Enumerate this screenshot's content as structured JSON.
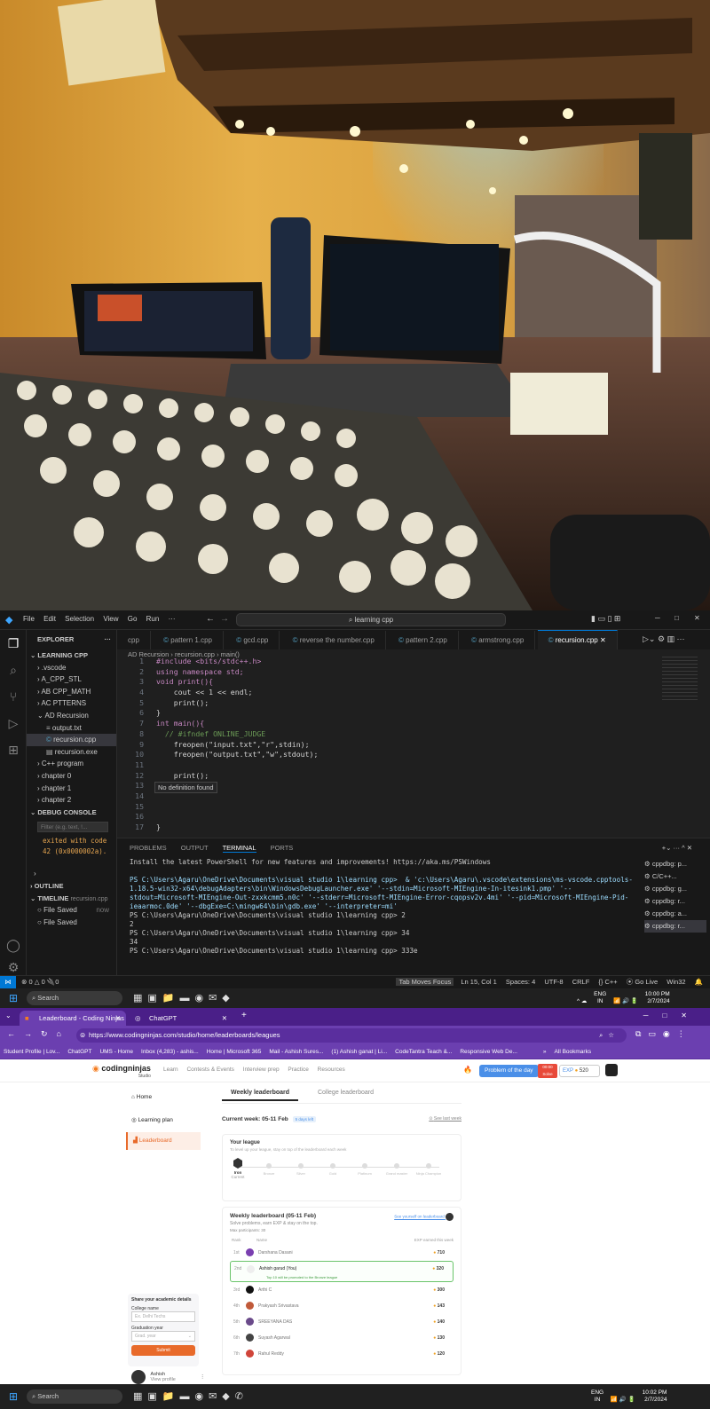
{
  "vscode": {
    "menu": [
      "File",
      "Edit",
      "Selection",
      "View",
      "Go",
      "Run",
      "···"
    ],
    "search_box": "learning cpp",
    "tabs": [
      "cpp",
      "pattern 1.cpp",
      "gcd.cpp",
      "reverse the number.cpp",
      "pattern 2.cpp",
      "armstrong.cpp",
      "recursion.cpp"
    ],
    "explorer_title": "EXPLORER",
    "explorer_more": "···",
    "tree": [
      "LEARNING CPP",
      ".vscode",
      "A_CPP_STL",
      "AB CPP_MATH",
      "AC PTTERNS",
      "AD Recursion",
      "output.txt",
      "recursion.cpp",
      "recursion.exe",
      "C++ program",
      "chapter 0",
      "chapter 1",
      "chapter 2"
    ],
    "debug_console": {
      "title": "DEBUG CONSOLE",
      "filter_placeholder": "Filter (e.g. text, !...",
      "output": "exited with code 42 (0x0000002a)."
    },
    "outline": "OUTLINE",
    "timeline": {
      "title": "TIMELINE",
      "file": "recursion.cpp",
      "entries": [
        {
          "label": "File Saved",
          "time": "now"
        },
        {
          "label": "File Saved",
          "time": ""
        }
      ]
    },
    "breadcrumb": [
      "AD Recursion",
      "recursion.cpp",
      "main()"
    ],
    "code": [
      {
        "n": "1",
        "t": "#include <bits/stdc++.h>"
      },
      {
        "n": "2",
        "t": "using namespace std;"
      },
      {
        "n": "3",
        "t": "void print(){"
      },
      {
        "n": "4",
        "t": "    cout << 1 << endl;"
      },
      {
        "n": "5",
        "t": "    print();"
      },
      {
        "n": "6",
        "t": "}"
      },
      {
        "n": "7",
        "t": "int main(){"
      },
      {
        "n": "8",
        "t": "  // #ifndef ONLINE_JUDGE"
      },
      {
        "n": "9",
        "t": "    freopen(\"input.txt\",\"r\",stdin);"
      },
      {
        "n": "10",
        "t": "    freopen(\"output.txt\",\"w\",stdout);"
      },
      {
        "n": "11",
        "t": ""
      },
      {
        "n": "12",
        "t": "    print();"
      },
      {
        "n": "13",
        "t": ""
      },
      {
        "n": "14",
        "t": ""
      },
      {
        "n": "15",
        "t": ""
      },
      {
        "n": "16",
        "t": ""
      },
      {
        "n": "17",
        "t": "}"
      }
    ],
    "hover_hint": "No definition found",
    "panel_tabs": [
      "PROBLEMS",
      "OUTPUT",
      "TERMINAL",
      "PORTS"
    ],
    "terminal": [
      "Install the latest PowerShell for new features and improvements! https://aka.ms/PSWindows",
      "",
      "PS C:\\Users\\Agaru\\OneDrive\\Documents\\visual studio 1\\learning cpp>  & 'c:\\Users\\Agaru\\.vscode\\extensions\\ms-vscode.cpptools-1.18.5-win32-x64\\debugAdapters\\bin\\WindowsDebugLauncher.exe' '--stdin=Microsoft-MIEngine-In-itesink1.pmp' '--stdout=Microsoft-MIEngine-Out-zxxkcmm5.n0c' '--stderr=Microsoft-MIEngine-Error-cqopsv2v.4mi' '--pid=Microsoft-MIEngine-Pid-ieaarmoc.0de' '--dbgExe=C:\\mingw64\\bin\\gdb.exe' '--interpreter=mi'",
      "PS C:\\Users\\Agaru\\OneDrive\\Documents\\visual studio 1\\learning cpp> 2",
      "2",
      "PS C:\\Users\\Agaru\\OneDrive\\Documents\\visual studio 1\\learning cpp> 34",
      "34",
      "PS C:\\Users\\Agaru\\OneDrive\\Documents\\visual studio 1\\learning cpp> 333e"
    ],
    "terminal_list": [
      "cppdbg: p...",
      "C/C++...",
      "cppdbg: g...",
      "cppdbg: r...",
      "cppdbg: a...",
      "cppdbg: r..."
    ],
    "status": {
      "errors": "0",
      "warnings": "0",
      "ports": "0",
      "tab_focus": "Tab Moves Focus",
      "position": "Ln 15, Col 1",
      "spaces": "Spaces: 4",
      "encoding": "UTF-8",
      "eol": "CRLF",
      "lang": "C++",
      "golive": "Go Live",
      "platform": "Win32"
    }
  },
  "taskbar1": {
    "search": "Search",
    "lang": "ENG",
    "region": "IN",
    "time": "10:00 PM",
    "date": "2/7/2024"
  },
  "chrome": {
    "tabs": [
      "Leaderboard - Coding Ninjas",
      "ChatGPT"
    ],
    "new_tab": "+",
    "url": "https://www.codingninjas.com/studio/home/leaderboards/leagues",
    "bookmarks": [
      "Student Profile | Lov...",
      "ChatGPT",
      "UMS - Home",
      "Inbox (4,283) - ashis...",
      "Home | Microsoft 365",
      "Mail - Ashish Sures...",
      "(1) Ashish ganat | Li...",
      "CodeTantra Teach &...",
      "Responsive Web De..."
    ],
    "bookmarks_more": "»",
    "all_bookmarks": "All Bookmarks"
  },
  "site": {
    "logo": "codingninjas",
    "logo_sub": "Studio",
    "nav": [
      "Learn",
      "Contests & Events",
      "Interview prep",
      "Practice",
      "Resources"
    ],
    "potd": "Problem of the day",
    "potd_badge": "00:00 Solve",
    "exp": "EXP",
    "exp_value": "520",
    "sidenav": [
      "Home",
      "Learning plan",
      "Leaderboard"
    ],
    "lb_tabs": [
      "Weekly leaderboard",
      "College leaderboard"
    ],
    "current_week": "Current week: 05-11 Feb",
    "days_left": "5 days left",
    "see_last_week": "See last week",
    "league_title": "Your league",
    "league_sub": "To level up your league, stay on top of the leaderboard each week",
    "league_current": "Iron",
    "league_current_sub": "Current",
    "leagues": [
      "Bronze",
      "Silver",
      "Gold",
      "Platinum",
      "Grand master",
      "Ninja Champion"
    ],
    "weekly_title": "Weekly leaderboard (05-11 Feb)",
    "see_self": "See yourself on leaderboard",
    "weekly_sub": "Solve problems, earn EXP & stay on the top.",
    "participants": "Max participants: 30",
    "col_rank": "Rank",
    "col_name": "Name",
    "col_exp": "EXP earned this week",
    "rows": [
      {
        "rank": "1st",
        "name": "Darshana Dasani",
        "exp": "710"
      },
      {
        "rank": "2nd",
        "name": "Ashish garud (You)",
        "exp": "320"
      },
      {
        "rank": "3rd",
        "name": "Arthi C",
        "exp": "300"
      },
      {
        "rank": "4th",
        "name": "Prakyash Srivastava",
        "exp": "143"
      },
      {
        "rank": "5th",
        "name": "SREEYANA DAS",
        "exp": "140"
      },
      {
        "rank": "6th",
        "name": "Suyash Agarwal",
        "exp": "130"
      },
      {
        "rank": "7th",
        "name": "Rahul Reddy",
        "exp": "120"
      }
    ],
    "promo": "Top 10 will be promoted to the Bronze league",
    "academic": {
      "title": "Share your academic details",
      "college_label": "College name",
      "college_placeholder": "Ex. Delhi Techs",
      "grad_label": "Graduation year",
      "grad_placeholder": "Grad. year",
      "submit": "Submit"
    },
    "profile_name": "Ashish",
    "profile_sub": "View profile"
  },
  "taskbar2": {
    "search": "Search",
    "lang": "ENG",
    "region": "IN",
    "time": "10:02 PM",
    "date": "2/7/2024"
  }
}
